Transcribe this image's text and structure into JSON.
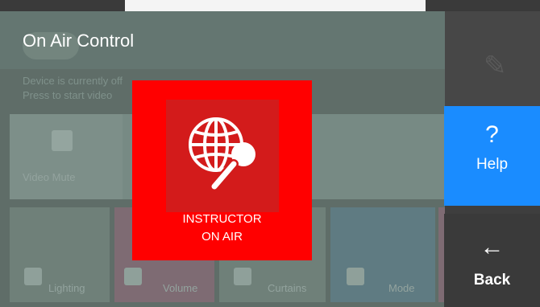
{
  "app": {
    "title": "On Air Control"
  },
  "background": {
    "status_line1": "Device is currently off",
    "status_line2": "Press to start video",
    "video_mute_label": "Video Mute",
    "tiles": [
      {
        "label": "Lighting"
      },
      {
        "label": "Volume"
      },
      {
        "label": "Curtains"
      },
      {
        "label": "Mode"
      }
    ]
  },
  "onair": {
    "label_line1": "INSTRUCTOR",
    "label_line2": "ON AIR",
    "color": "#ff0000",
    "icon": "globe-microphone-icon"
  },
  "rail": {
    "help_glyph": "?",
    "help_label": "Help",
    "back_glyph": "←",
    "back_label": "Back",
    "help_color": "#1a8cff"
  }
}
